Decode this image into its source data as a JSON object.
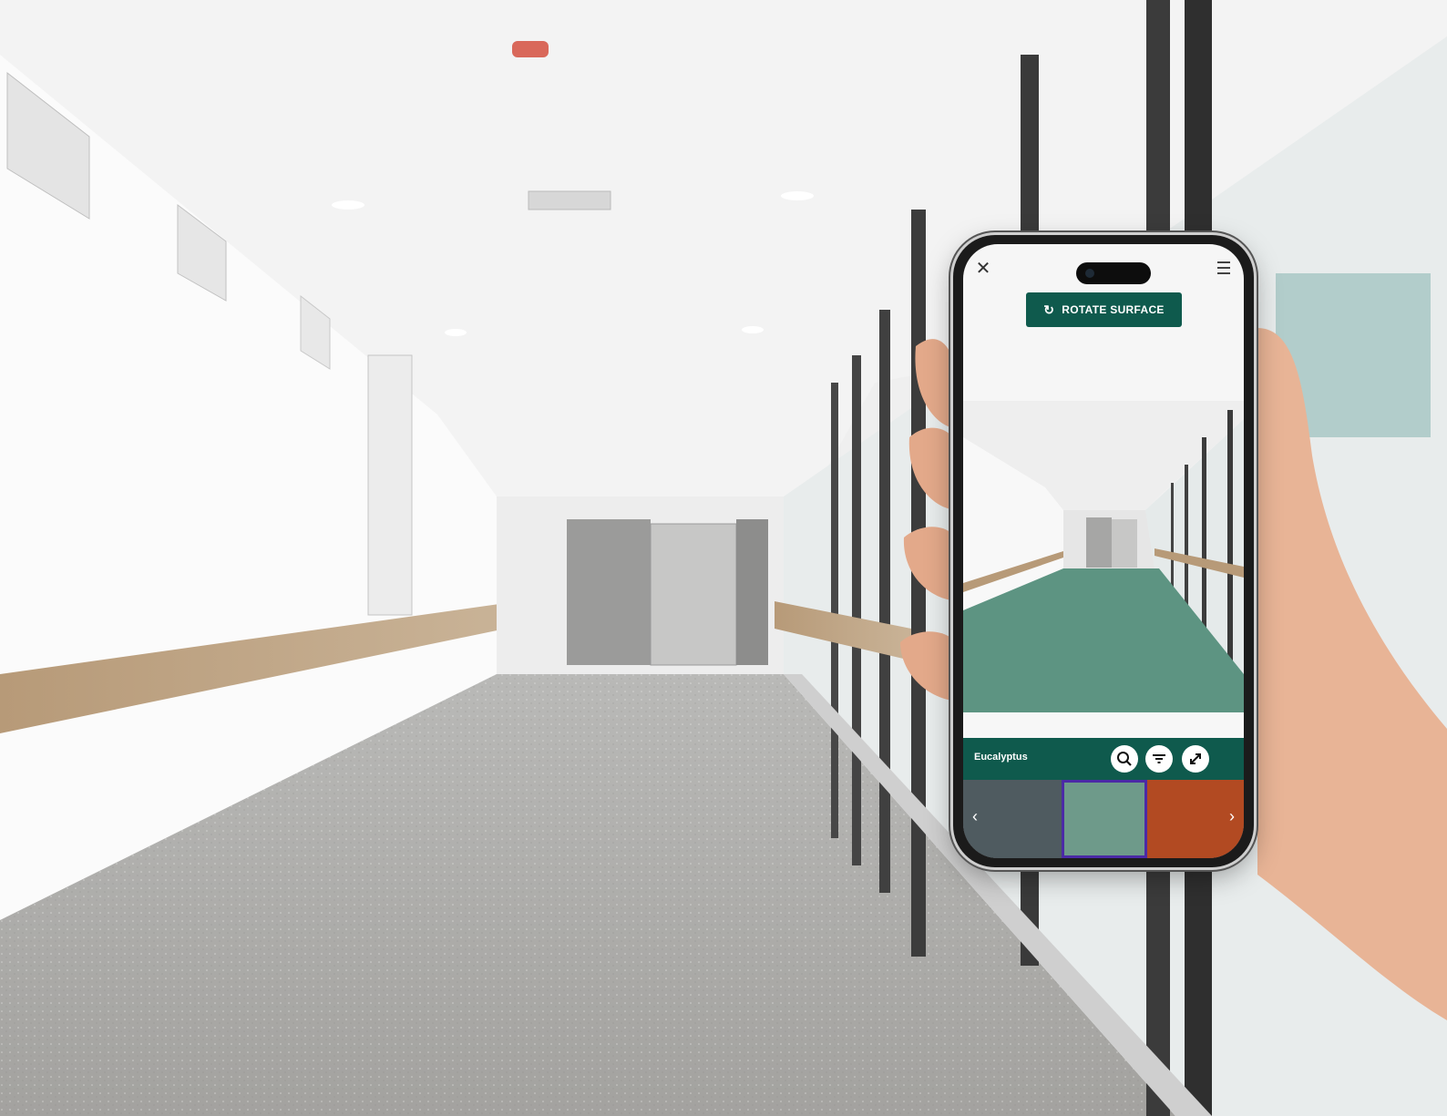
{
  "app": {
    "rotate_label": "ROTATE SURFACE",
    "close_icon": "close-icon",
    "menu_icon": "hamburger-menu-icon"
  },
  "selection": {
    "material_name": "Eucalyptus"
  },
  "swatches": [
    {
      "name": "dark-speckled-grey",
      "color": "#4f5b60"
    },
    {
      "name": "eucalyptus",
      "color": "#6e9a8a",
      "selected": true
    },
    {
      "name": "burnt-orange",
      "color": "#b24a22"
    }
  ],
  "colors": {
    "brand_green": "#0f5a4d",
    "floor_preview": "#5d9482",
    "selected_outline": "#4b2aa6"
  }
}
